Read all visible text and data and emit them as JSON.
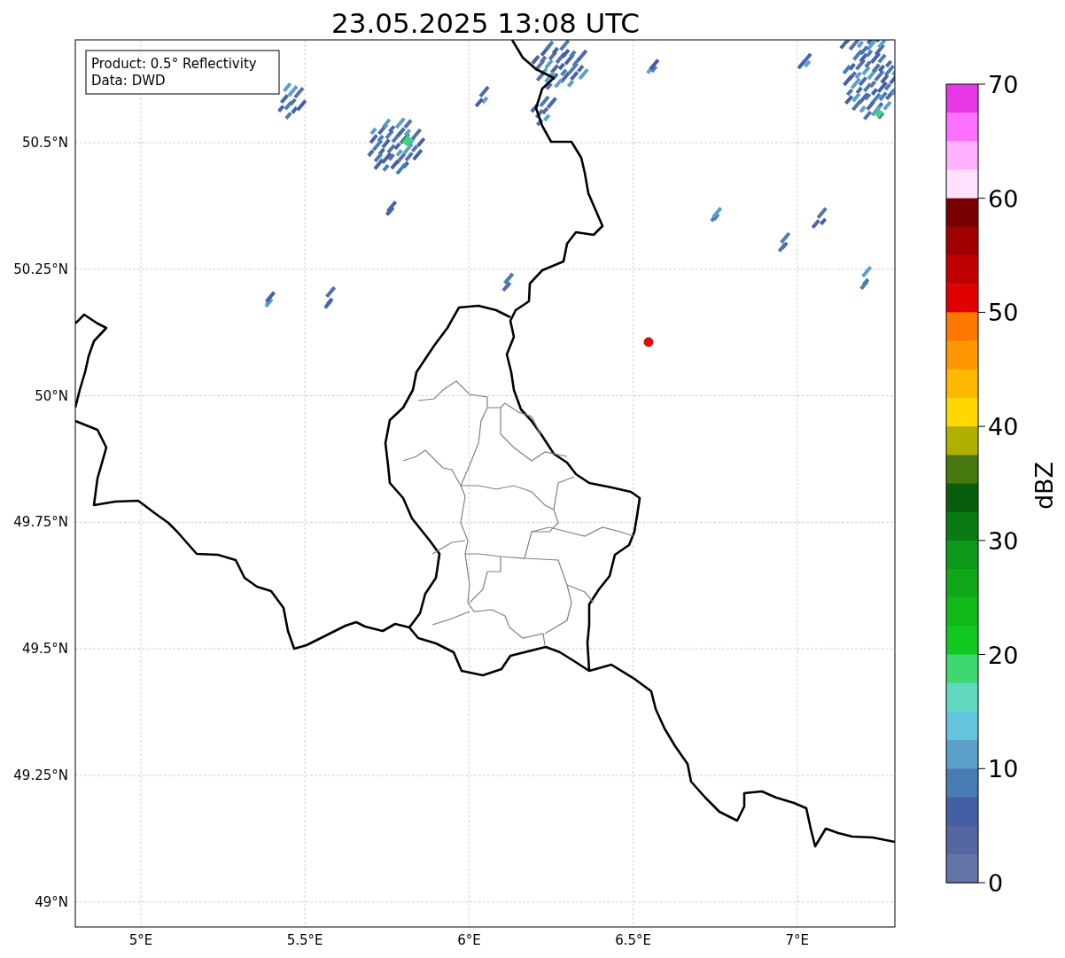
{
  "title": "23.05.2025 13:08 UTC",
  "info_box": {
    "lines": [
      "Product: 0.5° Reflectivity",
      "Data: DWD"
    ]
  },
  "map": {
    "lat_ticks": [
      "50.5°N",
      "50.25°N",
      "50°N",
      "49.75°N",
      "49.5°N",
      "49.25°N",
      "49°N"
    ],
    "lon_ticks": [
      "5°E",
      "5.5°E",
      "6°E",
      "6.5°E",
      "7°E"
    ]
  },
  "colorbar": {
    "ticks": [
      "70",
      "60",
      "50",
      "40",
      "30",
      "20",
      "10",
      "0"
    ],
    "label": "dBZ",
    "segments": [
      {
        "color": "#e838e8"
      },
      {
        "color": "#ff70ff"
      },
      {
        "color": "#ffb0ff"
      },
      {
        "color": "#ffe0ff"
      },
      {
        "color": "#780000"
      },
      {
        "color": "#a00000"
      },
      {
        "color": "#c00000"
      },
      {
        "color": "#e00000"
      },
      {
        "color": "#ff7800"
      },
      {
        "color": "#ff9800"
      },
      {
        "color": "#ffb800"
      },
      {
        "color": "#ffd800"
      },
      {
        "color": "#b0b000"
      },
      {
        "color": "#487810"
      },
      {
        "color": "#085e0c"
      },
      {
        "color": "#0a7a12"
      },
      {
        "color": "#0c9818"
      },
      {
        "color": "#10a818"
      },
      {
        "color": "#10b818"
      },
      {
        "color": "#10c820"
      },
      {
        "color": "#3ed870"
      },
      {
        "color": "#60d8c0"
      },
      {
        "color": "#64c4dc"
      },
      {
        "color": "#5aa0c8"
      },
      {
        "color": "#4a7cb4"
      },
      {
        "color": "#4460a4"
      },
      {
        "color": "#5566a0"
      },
      {
        "color": "#6473a5"
      }
    ]
  }
}
